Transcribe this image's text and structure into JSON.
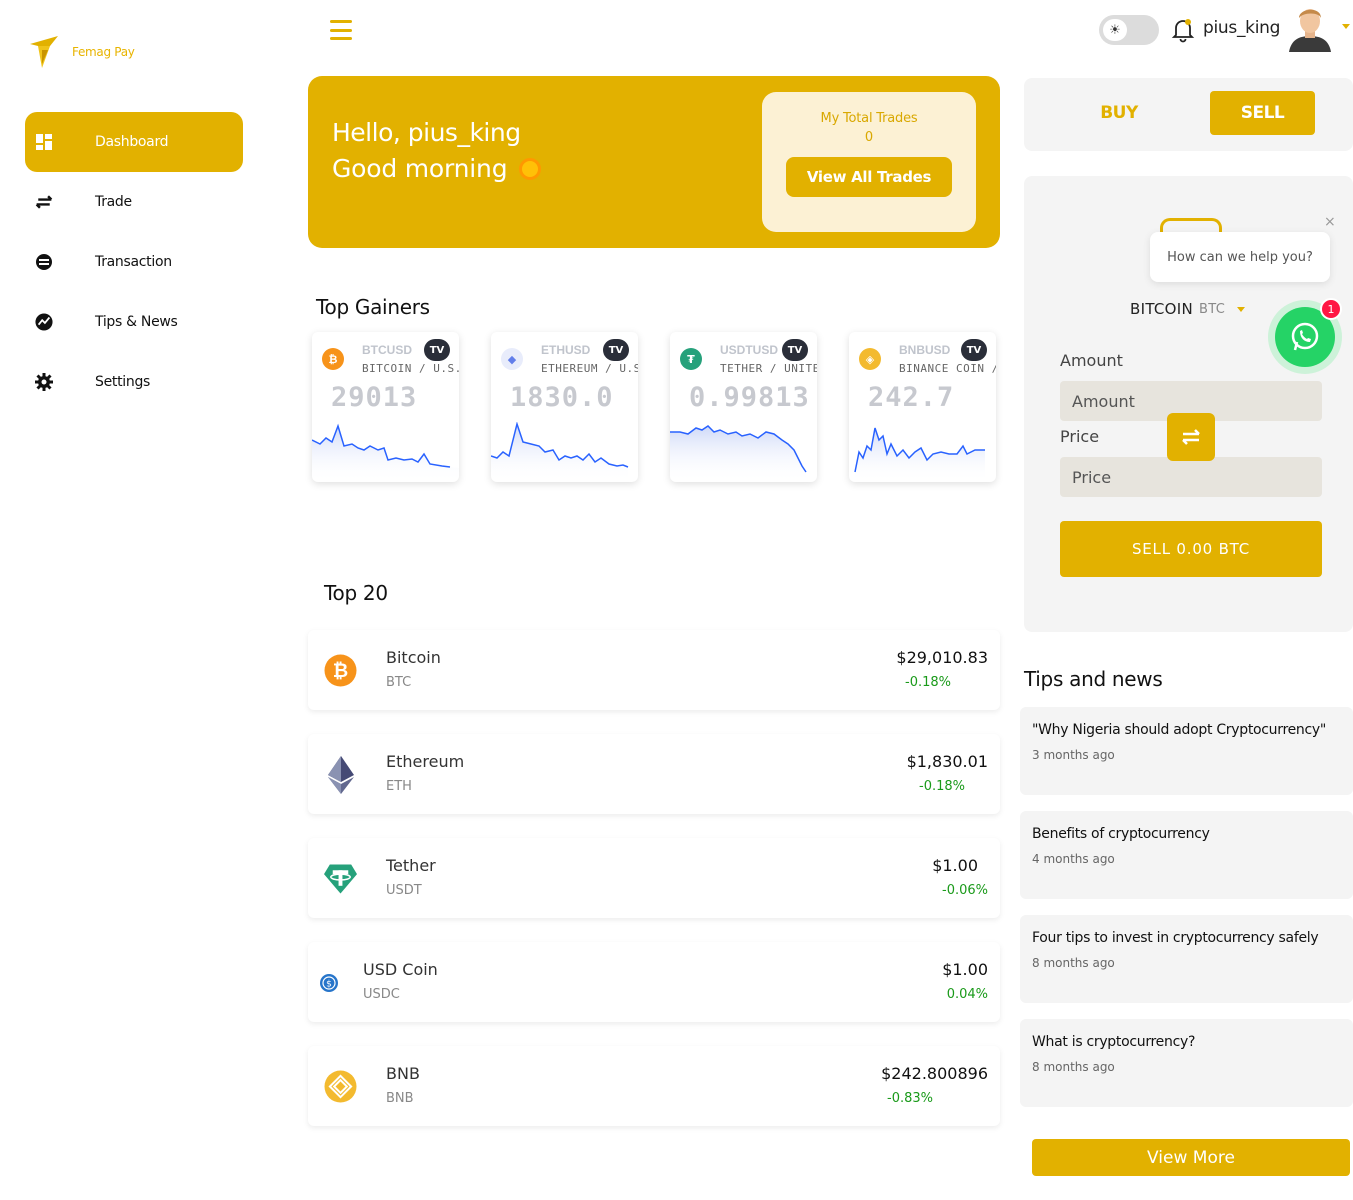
{
  "brand": {
    "name": "Femag Pay",
    "accent": "#e2b100"
  },
  "sidebar": {
    "items": [
      {
        "label": "Dashboard",
        "icon": "dashboard-icon",
        "active": true
      },
      {
        "label": "Trade",
        "icon": "swap-arrows-icon"
      },
      {
        "label": "Transaction",
        "icon": "transaction-icon"
      },
      {
        "label": "Tips & News",
        "icon": "trending-icon"
      },
      {
        "label": "Settings",
        "icon": "gear-icon"
      }
    ]
  },
  "header": {
    "username": "pius_king",
    "theme_icon": "sun-icon"
  },
  "hero": {
    "hello": "Hello, pius_king",
    "greeting": "Good morning",
    "trades_label": "My Total Trades",
    "trades_count": "0",
    "view_trades": "View All Trades"
  },
  "gainers": {
    "title": "Top Gainers",
    "items": [
      {
        "symbol": "BTCUSD",
        "name": "BITCOIN / U.S. D",
        "price": "29013",
        "icon": "bitcoin-icon",
        "color": "#f7931a"
      },
      {
        "symbol": "ETHUSD",
        "name": "ETHEREUM / U.S",
        "price": "1830.0",
        "icon": "ethereum-icon",
        "color": "#627eea"
      },
      {
        "symbol": "USDTUSD",
        "name": "TETHER / UNITED",
        "price": "0.99813",
        "icon": "tether-icon",
        "color": "#26a17b"
      },
      {
        "symbol": "BNBUSD",
        "name": "BINANCE COIN /",
        "price": "242.7",
        "icon": "bnb-icon",
        "color": "#f3ba2f"
      }
    ]
  },
  "top20": {
    "title": "Top 20",
    "coins": [
      {
        "name": "Bitcoin",
        "symbol": "BTC",
        "price": "$29,010.83",
        "change": "-0.18%",
        "icon": "bitcoin-icon"
      },
      {
        "name": "Ethereum",
        "symbol": "ETH",
        "price": "$1,830.01",
        "change": "-0.18%",
        "icon": "ethereum-icon"
      },
      {
        "name": "Tether",
        "symbol": "USDT",
        "price": "$1.00",
        "change": "-0.06%",
        "icon": "tether-icon"
      },
      {
        "name": "USD Coin",
        "symbol": "USDC",
        "price": "$1.00",
        "change": "0.04%",
        "icon": "usdc-icon"
      },
      {
        "name": "BNB",
        "symbol": "BNB",
        "price": "$242.800896",
        "change": "-0.83%",
        "icon": "bnb-icon"
      }
    ]
  },
  "trade": {
    "buy": "BUY",
    "sell": "SELL",
    "coin": "BITCOIN",
    "coin_symbol": "BTC",
    "amount_label": "Amount",
    "amount_placeholder": "Amount",
    "price_label": "Price",
    "price_placeholder": "Price",
    "submit": "SELL 0.00 BTC"
  },
  "support": {
    "prompt": "How can we help you?",
    "close": "×",
    "badge": "1"
  },
  "news": {
    "title": "Tips and news",
    "items": [
      {
        "title": "\"Why Nigeria should adopt Cryptocurrency\"",
        "time": "3 months ago"
      },
      {
        "title": "Benefits of cryptocurrency",
        "time": "4 months ago"
      },
      {
        "title": "Four tips to invest in cryptocurrency safely",
        "time": "8 months ago"
      },
      {
        "title": "What is cryptocurrency?",
        "time": "8 months ago"
      }
    ],
    "view_more": "View More"
  }
}
